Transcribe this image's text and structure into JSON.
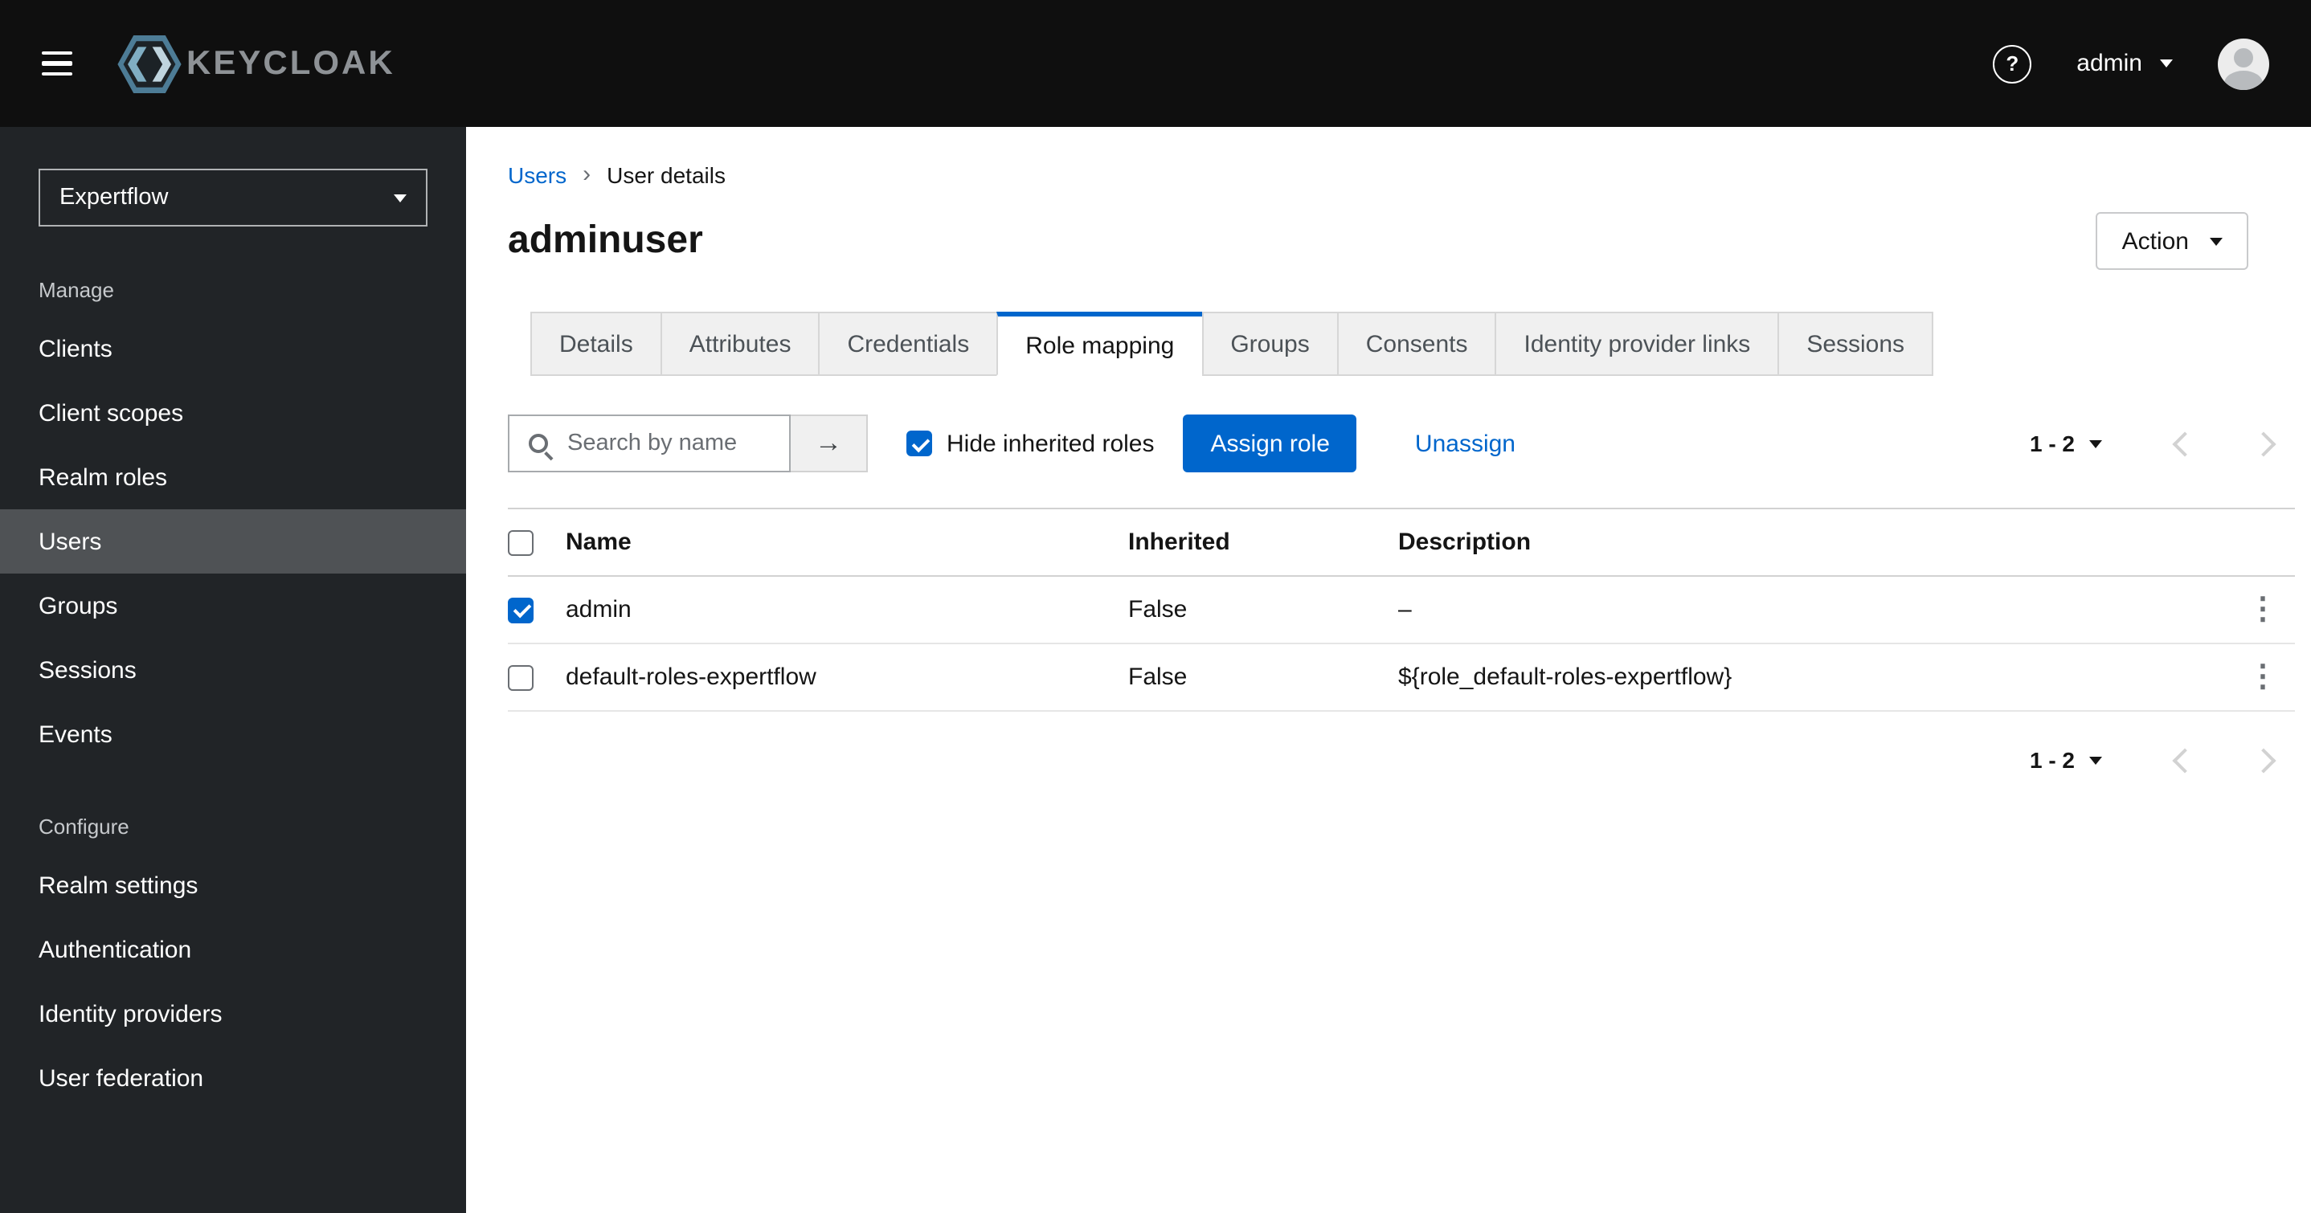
{
  "header": {
    "brand": "KEYCLOAK",
    "username": "admin"
  },
  "icons": {
    "help": "?",
    "kebab": "⋮",
    "breadcrumb_separator": "›",
    "arrow_right": "→"
  },
  "sidebar": {
    "realm_selector": "Expertflow",
    "active_item": "Users",
    "sections": [
      {
        "label": "Manage",
        "items": [
          "Clients",
          "Client scopes",
          "Realm roles",
          "Users",
          "Groups",
          "Sessions",
          "Events"
        ]
      },
      {
        "label": "Configure",
        "items": [
          "Realm settings",
          "Authentication",
          "Identity providers",
          "User federation"
        ]
      }
    ]
  },
  "breadcrumb": {
    "parent": "Users",
    "current": "User details"
  },
  "page": {
    "title": "adminuser",
    "action_button": "Action"
  },
  "tabs": [
    {
      "label": "Details",
      "active": false
    },
    {
      "label": "Attributes",
      "active": false
    },
    {
      "label": "Credentials",
      "active": false
    },
    {
      "label": "Role mapping",
      "active": true
    },
    {
      "label": "Groups",
      "active": false
    },
    {
      "label": "Consents",
      "active": false
    },
    {
      "label": "Identity provider links",
      "active": false
    },
    {
      "label": "Sessions",
      "active": false
    }
  ],
  "toolbar": {
    "search_placeholder": "Search by name",
    "hide_inherited_label": "Hide inherited roles",
    "hide_inherited_checked": true,
    "assign_button": "Assign role",
    "unassign_link": "Unassign"
  },
  "pagination": {
    "range": "1 - 2"
  },
  "table": {
    "columns": [
      "Name",
      "Inherited",
      "Description"
    ],
    "rows": [
      {
        "checked": true,
        "name": "admin",
        "inherited": "False",
        "description": "–"
      },
      {
        "checked": false,
        "name": "default-roles-expertflow",
        "inherited": "False",
        "description": "${role_default-roles-expertflow}"
      }
    ]
  },
  "colors": {
    "primary": "#0066cc",
    "masthead_bg": "#0f0f0f",
    "sidebar_bg": "#212427",
    "nav_selected_bg": "#4f5255",
    "tab_inactive_bg": "#f0f0f0",
    "active_tab_accent": "#0066cc"
  }
}
